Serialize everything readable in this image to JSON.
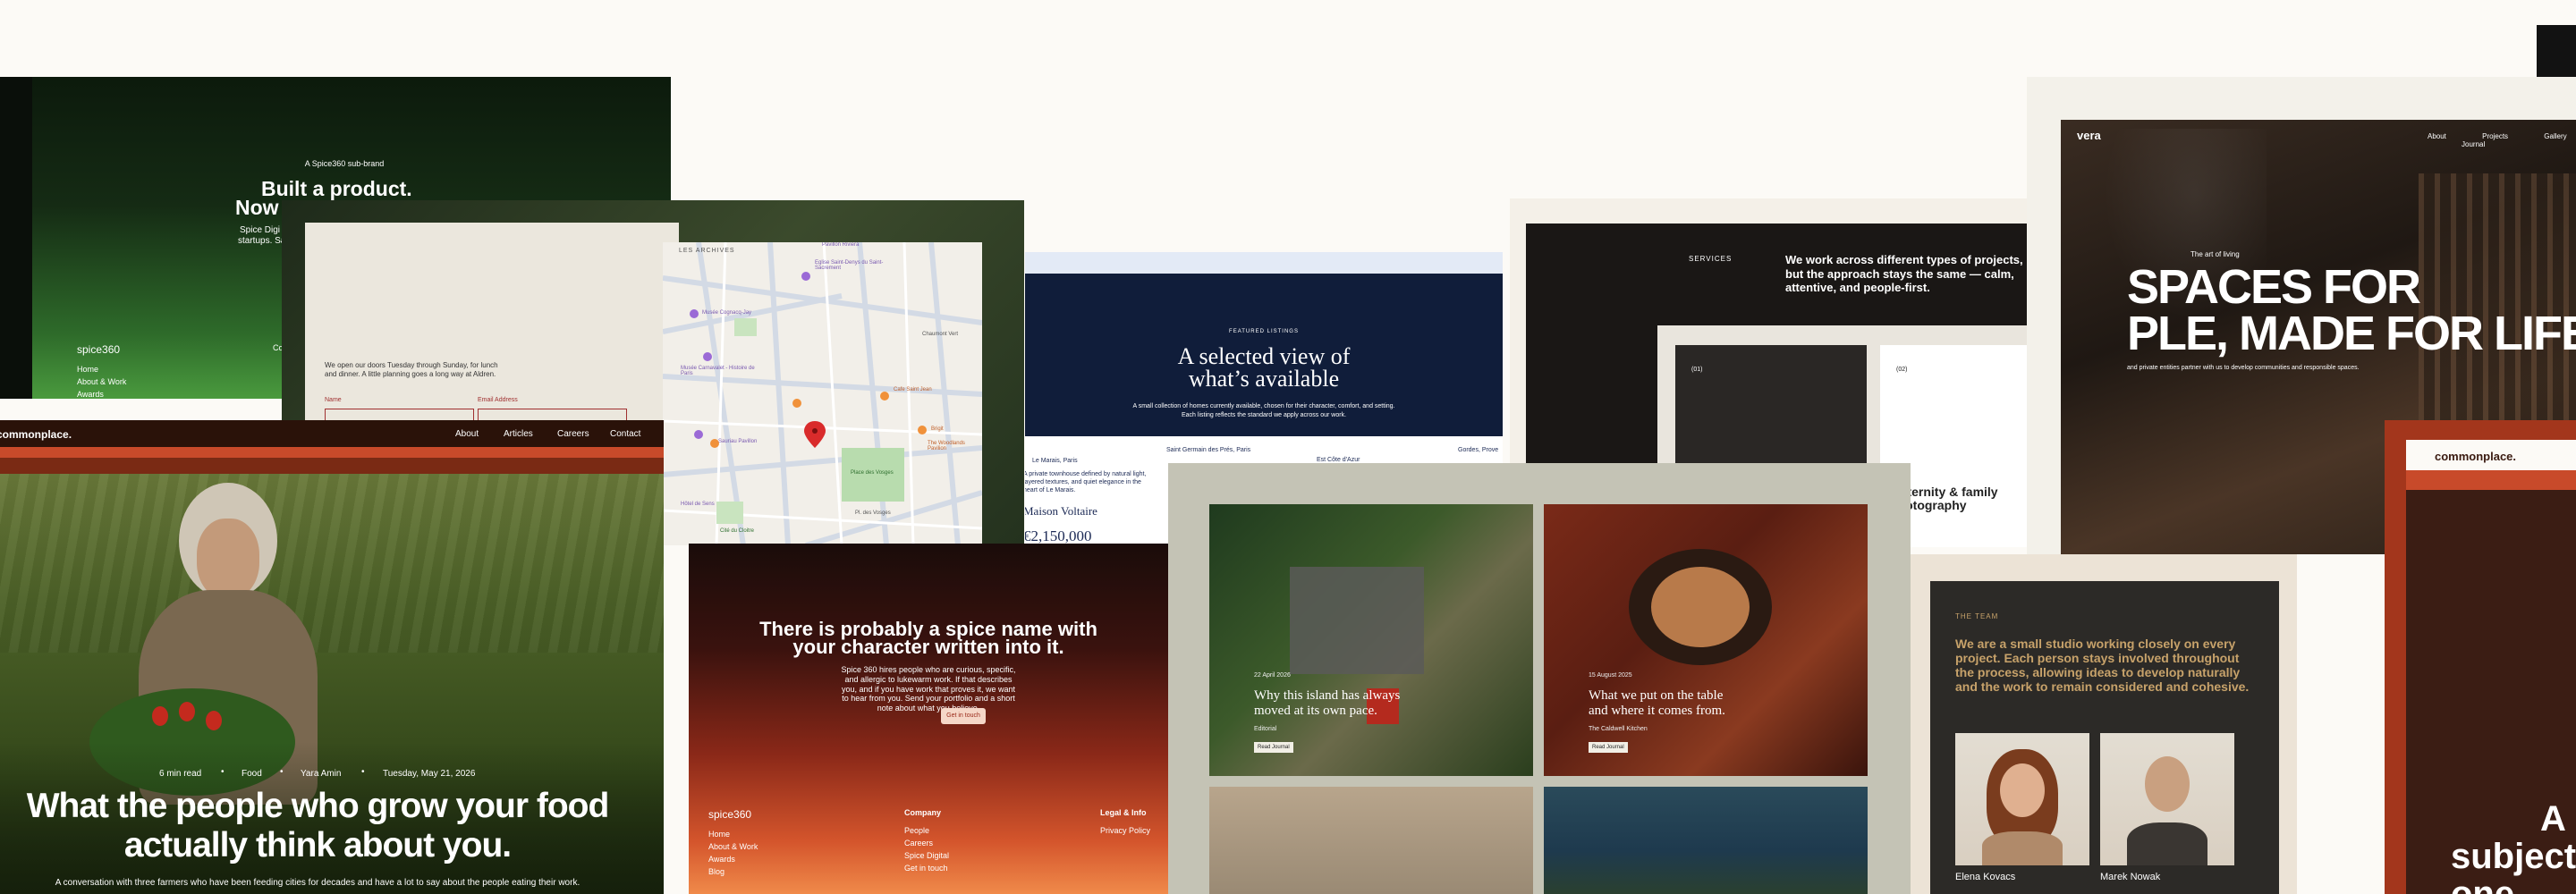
{
  "spice_green": {
    "kicker": "A Spice360 sub-brand",
    "headline_1": "Built a product.",
    "headline_2": "Now",
    "sub": "Spice Digi",
    "sub2": "startups. Sa",
    "logo": "spice360",
    "links": [
      "Home",
      "About & Work",
      "Awards"
    ],
    "col": "Co"
  },
  "contact_map": {
    "intro": "We open our doors Tuesday through Sunday, for lunch and dinner. A little planning goes a long way at Aldren.",
    "field_name": "Name",
    "field_email": "Email Address",
    "map_labels": [
      "LES ARCHIVES",
      "Pavillon Riviera",
      "Musée Cognacq-Jay",
      "Eglise Saint-Denys du Saint-Sacrement",
      "Musée Carnavalet - Histoire de Paris",
      "Cafe Saint Jean",
      "Chaumont Vert",
      "Sauriau Pavillon",
      "Place des Vosges",
      "Cité du Cloitre",
      "Brigit",
      "The Woodlands Pavilion",
      "Hôtel de Sens",
      "Pl. des Vosges"
    ]
  },
  "listings": {
    "kicker": "FEATURED LISTINGS",
    "title_1": "A selected view of",
    "title_2": "what’s available",
    "sub": "A small collection of homes currently available, chosen for their character, comfort, and setting. Each listing reflects the standard we apply across our work.",
    "tabs": [
      "Saint Germain des Prés, Paris",
      "Est Côte d'Azur",
      "Gordes, Prove"
    ],
    "location": "Le Marais, Paris",
    "desc": "A private townhouse defined by natural light, layered textures, and quiet elegance in the heart of Le Marais.",
    "name": "Maison Voltaire",
    "price": "€2,150,000"
  },
  "services": {
    "label": "SERVICES",
    "text": "We work across different types of projects, but the approach stays the same — calm, attentive, and people-first.",
    "card1_num": "(01)",
    "card2_num": "(02)",
    "card2_title_1": "Maternity & family",
    "card2_title_2": "photography"
  },
  "vera": {
    "logo": "vera",
    "nav": [
      "About",
      "Projects",
      "Gallery",
      "Journal"
    ],
    "kicker": "The art of living",
    "headline_1": "SPACES FOR",
    "headline_2": "PLE, MADE FOR LIFE.",
    "sub": "and private entities partner with us to develop communities and responsible spaces."
  },
  "commonplace_left": {
    "logo": "commonplace.",
    "nav": [
      "About",
      "Articles",
      "Careers",
      "Contact"
    ],
    "meta": [
      "6 min read",
      "Food",
      "Yara Amin",
      "Tuesday, May 21, 2026"
    ],
    "headline_1": "What the people who grow your food",
    "headline_2": "actually think about you.",
    "sub": "A conversation with three farmers who have been feeding cities for decades and have a lot to say about the people eating their work."
  },
  "careers": {
    "headline_1": "There is probably a spice name with",
    "headline_2": "your character written into it.",
    "body": "Spice 360 hires people who are curious, specific, and allergic to lukewarm work. If that describes you, and if you have work that proves it, we want to hear from you. Send your portfolio and a short note about what you believe.",
    "cta": "Get in touch",
    "logo": "spice360",
    "col1": [
      "Home",
      "About & Work",
      "Awards",
      "Blog"
    ],
    "col2_title": "Company",
    "col2": [
      "People",
      "Careers",
      "Spice Digital",
      "Get in touch"
    ],
    "col3_title": "Legal & Info",
    "col3": [
      "Privacy Policy"
    ]
  },
  "journal": {
    "card1_date": "22 April 2026",
    "card1_title_1": "Why this island has always",
    "card1_title_2": "moved at its own pace.",
    "card1_cat": "Editorial",
    "card1_btn": "Read Journal",
    "card2_date": "15 August 2025",
    "card2_title_1": "What we put on the table",
    "card2_title_2": "and where it comes from.",
    "card2_cat": "The Caldwell Kitchen",
    "card2_btn": "Read Journal"
  },
  "team": {
    "label": "THE TEAM",
    "text": "We are a small studio working closely on every project. Each person stays involved throughout the process, allowing ideas to develop naturally and the work to remain considered and cohesive.",
    "member1": "Elena Kovacs",
    "member2": "Marek Nowak"
  },
  "commonplace_right": {
    "logo": "commonplace.",
    "headline_1": "A p",
    "headline_2": "subject",
    "headline_3": "one."
  },
  "colors": {
    "page_bg": "#fcfaf6",
    "navy": "#101d3a",
    "rust": "#a3361c",
    "green_glow": "#3f8f3a",
    "team_accent": "#c7a26a"
  }
}
